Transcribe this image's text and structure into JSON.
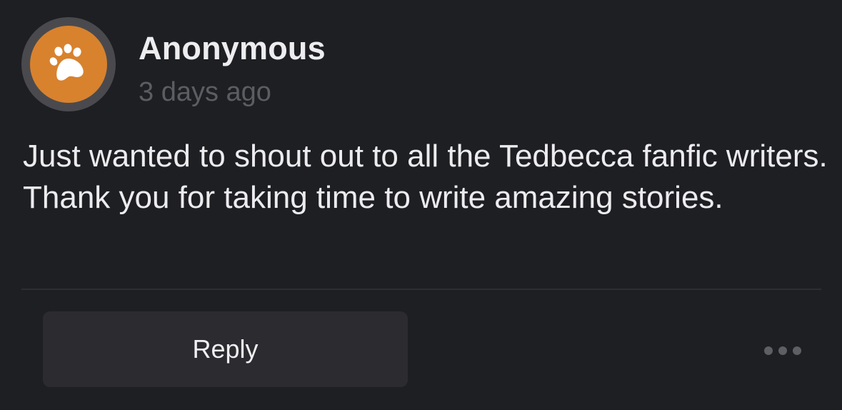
{
  "post": {
    "author": "Anonymous",
    "timestamp": "3 days ago",
    "avatar_icon": "paw-print-icon",
    "avatar_color": "#d8822e",
    "body": "Just wanted to shout out to all the Tedbecca fanfic writers.  Thank you for taking time to write amazing stories."
  },
  "actions": {
    "reply_label": "Reply",
    "more_icon": "more-horizontal-icon"
  }
}
